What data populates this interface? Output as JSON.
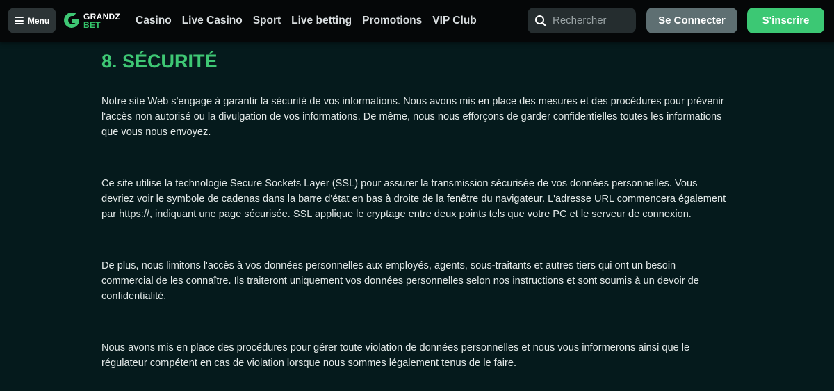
{
  "header": {
    "menu_label": "Menu",
    "logo": {
      "top": "GRANDZ",
      "bottom": "BET"
    },
    "nav": [
      "Casino",
      "Live Casino",
      "Sport",
      "Live betting",
      "Promotions",
      "VIP Club"
    ],
    "search_placeholder": "Rechercher",
    "login_label": "Se Connecter",
    "signup_label": "S'inscrire"
  },
  "colors": {
    "accent": "#3ec774",
    "background": "#051a1c",
    "header": "#050708"
  },
  "section": {
    "title": "8. SÉCURITÉ",
    "paragraphs": [
      "Notre site Web s'engage à garantir la sécurité de vos informations. Nous avons mis en place des mesures et des procédures pour prévenir l'accès non autorisé ou la divulgation de vos informations. De même, nous nous efforçons de garder confidentielles toutes les informations que vous nous envoyez.",
      "Ce site utilise la technologie Secure Sockets Layer (SSL) pour assurer la transmission sécurisée de vos données personnelles. Vous devriez voir le symbole de cadenas dans la barre d'état en bas à droite de la fenêtre du navigateur. L'adresse URL commencera également par https://, indiquant une page sécurisée. SSL applique le cryptage entre deux points tels que votre PC et le serveur de connexion.",
      "De plus, nous limitons l'accès à vos données personnelles aux employés, agents, sous-traitants et autres tiers qui ont un besoin commercial de les connaître. Ils traiteront uniquement vos données personnelles selon nos instructions et sont soumis à un devoir de confidentialité.",
      "Nous avons mis en place des procédures pour gérer toute violation de données personnelles et nous vous informerons ainsi que le régulateur compétent en cas de violation lorsque nous sommes légalement tenus de le faire."
    ]
  }
}
